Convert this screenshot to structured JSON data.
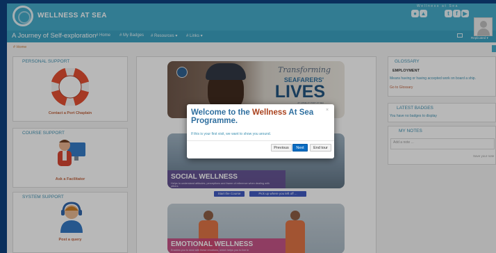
{
  "header": {
    "brand": "WELLNESS AT SEA",
    "social_label": "Wellness at Sea",
    "social_icons": [
      "apple-icon",
      "android-icon",
      "twitter-icon",
      "facebook-icon",
      "youtube-icon"
    ]
  },
  "nav": {
    "tagline": "A Journey of Self-exploration",
    "items": [
      "# Home",
      "# My Badges",
      "# Resources ▾",
      "# Links ▾"
    ],
    "user": "Replicated ▾"
  },
  "breadcrumb": "# Home",
  "left": {
    "personal": {
      "title": "PERSONAL SUPPORT",
      "link": "Contact a Port Chaplain"
    },
    "course": {
      "title": "COURSE SUPPORT",
      "link": "Ask a Facilitator"
    },
    "system": {
      "title": "SYSTEM SUPPORT",
      "link": "Post a query"
    }
  },
  "center": {
    "banner1": {
      "line1": "Transforming",
      "line2": "SEAFARERS'",
      "line3": "LIVES",
      "foot": "AT HOME   AT PORT   AT SEA"
    },
    "banner2": {
      "title": "SOCIAL WELLNESS",
      "text": "Helps to understand attitudes, perceptions and frame of reference when dealing with others"
    },
    "buttons": {
      "start": "Start the Course",
      "resume": "Pick up where you left off ..."
    },
    "banner3": {
      "title": "EMOTIONAL WELLNESS",
      "text": "Enables you to deal with these emotions, which helps you to live in"
    }
  },
  "modal": {
    "title_pre": "Welcome to the",
    "title_hl": "Wellness",
    "title_post": "At Sea Programme.",
    "close": "×",
    "body": "If this is your first visit, we want to show you around.",
    "prev": "Previous",
    "next": "Next",
    "end": "End tour"
  },
  "right": {
    "glossary": {
      "title": "GLOSSARY",
      "term": "EMPLOYMENT",
      "def": "Means having or having accepted work on board a ship.",
      "link": "Go to Glossary"
    },
    "badges": {
      "title": "LATEST BADGES",
      "text": "You have no badges to display"
    },
    "notes": {
      "title": "MY NOTES",
      "placeholder": "Add a note ...",
      "save": "Save your note"
    }
  }
}
